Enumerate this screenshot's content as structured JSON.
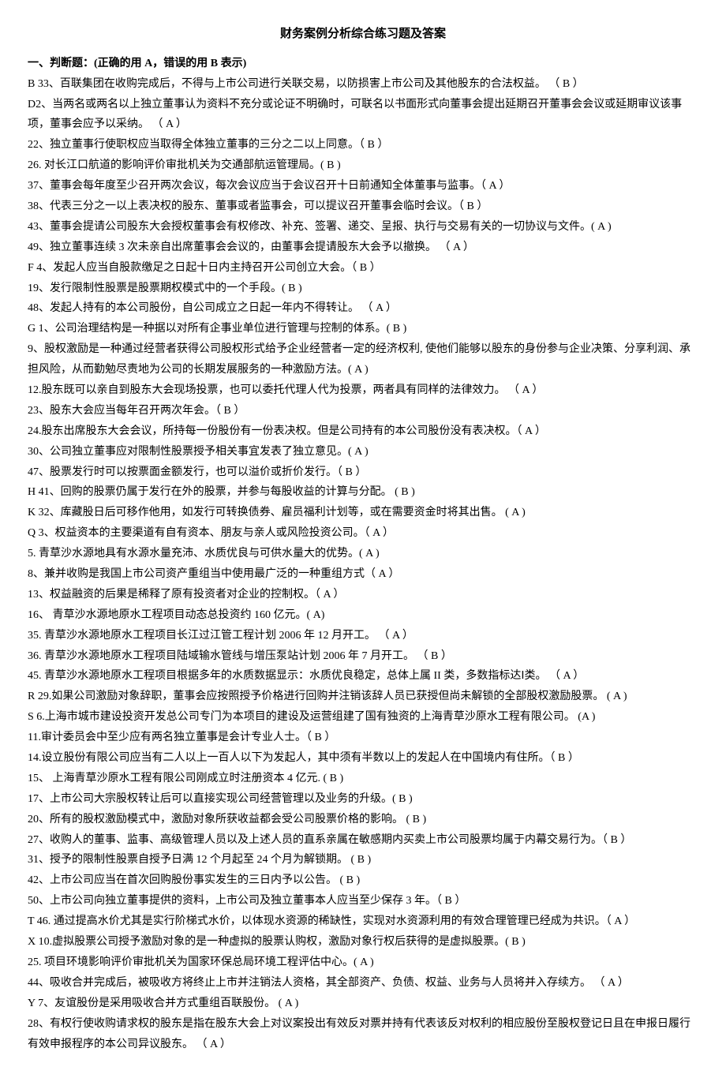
{
  "title": "财务案例分析综合练习题及答案",
  "section_header": "一、判断题：(正确的用 A，错误的用 B 表示)",
  "questions": [
    "B 33、百联集团在收购完成后，不得与上市公司进行关联交易，以防损害上市公司及其他股东的合法权益。 （ B ）",
    "D2、当两名或两名以上独立董事认为资料不充分或论证不明确时，可联名以书面形式向董事会提出延期召开董事会会议或延期审议该事项，董事会应予以采纳。 （ A ）",
    "22、独立董事行使职权应当取得全体独立董事的三分之二以上同意。（ B ）",
    "26. 对长江口航道的影响评价审批机关为交通部航运管理局。( B )",
    "37、董事会每年度至少召开两次会议，每次会议应当于会议召开十日前通知全体董事与监事。（ A ）",
    "38、代表三分之一以上表决权的股东、董事或者监事会，可以提议召开董事会临时会议。（ B ）",
    "43、董事会提请公司股东大会授权董事会有权修改、补充、签署、递交、呈报、执行与交易有关的一切协议与文件。(  A  )",
    "49、独立董事连续 3 次未亲自出席董事会会议的，由董事会提请股东大会予以撤换。 （ A ）",
    "F 4、发起人应当自股款缴足之日起十日内主持召开公司创立大会。（ B ）",
    "19、发行限制性股票是股票期权模式中的一个手段。(  B  )",
    "48、发起人持有的本公司股份，自公司成立之日起一年内不得转让。             （ A ）",
    "G 1、公司治理结构是一种据以对所有企事业单位进行管理与控制的体系。( B )",
    "9、股权激励是一种通过经营者获得公司股权形式给予企业经营者一定的经济权利, 使他们能够以股东的身份参与企业决策、分享利润、承担风险，从而勤勉尽责地为公司的长期发展服务的一种激励方法。(  A  )",
    "12.股东既可以亲自到股东大会现场投票，也可以委托代理人代为投票，两者具有同样的法律效力。 （ A ）",
    "23、股东大会应当每年召开两次年会。（ B ）",
    "24.股东出席股东大会会议，所持每一份股份有一份表决权。但是公司持有的本公司股份没有表决权。（ A ）",
    "30、公司独立董事应对限制性股票授予相关事宜发表了独立意见。(  A  )",
    "47、股票发行时可以按票面金额发行，也可以溢价或折价发行。（ B ）",
    "H 41、回购的股票仍属于发行在外的股票，并参与每股收益的计算与分配。         (  B  )",
    "K 32、库藏股日后可移作他用，如发行可转换债券、雇员福利计划等，或在需要资金时将其出售。   (  A  )",
    "Q 3、权益资本的主要渠道有自有资本、朋友与亲人或风险投资公司。（ A ）",
    "5. 青草沙水源地具有水源水量充沛、水质优良与可供水量大的优势。( A  )",
    "8、兼并收购是我国上市公司资产重组当中使用最广泛的一种重组方式（ A ）",
    "13、权益融资的后果是稀释了原有投资者对企业的控制权。（ A ）",
    "16、 青草沙水源地原水工程项目动态总投资约 160 亿元。(  A)",
    "35. 青草沙水源地原水工程项目长江过江管工程计划 2006 年 12 月开工。 （ A ）",
    "36. 青草沙水源地原水工程项目陆域输水管线与增压泵站计划 2006 年 7 月开工。 （ B ）",
    "45. 青草沙水源地原水工程项目根据多年的水质数据显示：水质优良稳定，总体上属 II 类，多数指标达Ⅰ类。 （ A ）",
    "R 29.如果公司激励对象辞职，董事会应按照授予价格进行回购并注销该辞人员已获授但尚未解锁的全部股权激励股票。  (  A  )",
    "S 6.上海市城市建设投资开发总公司专门为本项目的建设及运营组建了国有独资的上海青草沙原水工程有限公司。  (A  )",
    "11.审计委员会中至少应有两名独立董事是会计专业人士。（ B ）",
    "14.设立股份有限公司应当有二人以上一百人以下为发起人，其中须有半数以上的发起人在中国境内有住所。（ B ）",
    "15、 上海青草沙原水工程有限公司刚成立时注册资本 4 亿元. ( B  )",
    "17、上市公司大宗股权转让后可以直接实现公司经营管理以及业务的升级。(  B  )",
    "20、所有的股权激励模式中，激励对象所获收益都会受公司股票价格的影响。    (  B  )",
    "27、收购人的董事、监事、高级管理人员以及上述人员的直系亲属在敏感期内买卖上市公司股票均属于内幕交易行为。（ B  ）",
    "31、授予的限制性股票自授予日满 12 个月起至 24 个月为解锁期。              (  B  )",
    "42、上市公司应当在首次回购股份事实发生的三日内予以公告。              (  B  )",
    "50、上市公司向独立董事提供的资料，上市公司及独立董事本人应当至少保存 3 年。（ B ）",
    "T 46. 通过提高水价尤其是实行阶梯式水价，以体现水资源的稀缺性，实现对水资源利用的有效合理管理已经成为共识。（ A ）",
    "X 10.虚拟股票公司授予激励对象的是一种虚拟的股票认购权，激励对象行权后获得的是虚拟股票。(  B  )",
    "25. 项目环境影响评价审批机关为国家环保总局环境工程评估中心。( A )",
    "44、吸收合并完成后，被吸收方将终止上市并注销法人资格，其全部资产、负债、权益、业务与人员将并入存续方。  （ A ）",
    "Y 7、友谊股份是采用吸收合并方式重组百联股份。  ( A )",
    "28、有权行使收购请求权的股东是指在股东大会上对议案投出有效反对票并持有代表该反对权利的相应股份至股权登记日且在申报日履行有效申报程序的本公司异议股东。  （ A ）"
  ]
}
